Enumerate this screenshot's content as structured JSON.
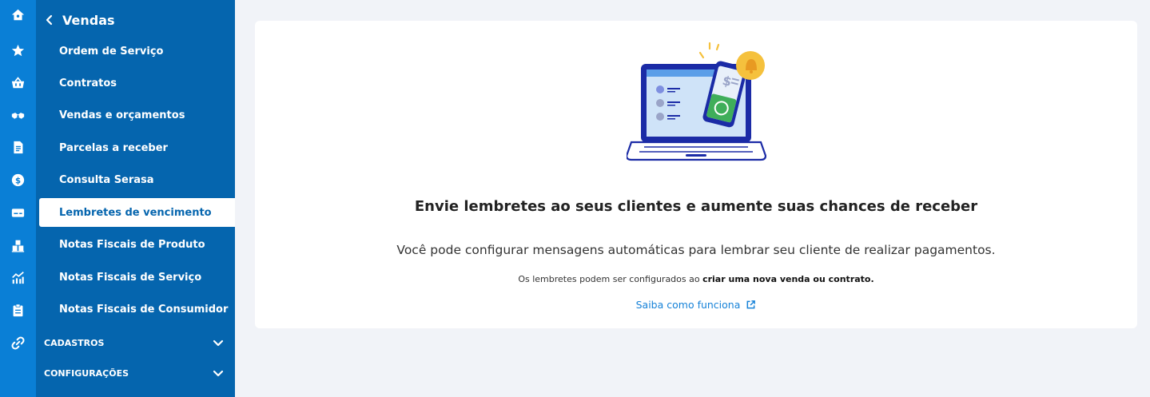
{
  "sidebar": {
    "rail_icons": [
      "home-icon",
      "star-icon",
      "basket-icon",
      "handshake-icon",
      "document-icon",
      "dollar-icon",
      "card-icon",
      "boxes-icon",
      "chart-icon",
      "clipboard-icon",
      "link-icon"
    ],
    "header": {
      "title": "Vendas",
      "back_icon": "chevron-left-icon"
    },
    "items": [
      {
        "label": "Ordem de Serviço"
      },
      {
        "label": "Contratos"
      },
      {
        "label": "Vendas e orçamentos"
      },
      {
        "label": "Parcelas a receber"
      },
      {
        "label": "Consulta Serasa"
      },
      {
        "label": "Lembretes de vencimento",
        "active": true
      },
      {
        "label": "Notas Fiscais de Produto"
      },
      {
        "label": "Notas Fiscais de Serviço"
      },
      {
        "label": "Notas Fiscais de Consumidor"
      }
    ],
    "sections": [
      {
        "label": "CADASTROS"
      },
      {
        "label": "CONFIGURAÇÕES"
      }
    ]
  },
  "main": {
    "title": "Envie lembretes ao seus clientes e aumente suas chances de receber",
    "description": "Você pode configurar mensagens automáticas para lembrar seu cliente de realizar pagamentos.",
    "note_prefix": "Os lembretes podem ser configurados ao ",
    "note_bold": "criar uma nova venda ou contrato.",
    "link_label": "Saiba como funciona"
  },
  "colors": {
    "rail": "#0a7fd6",
    "menu": "#0565ae",
    "link": "#1682d8",
    "background": "#f1f3f8"
  }
}
